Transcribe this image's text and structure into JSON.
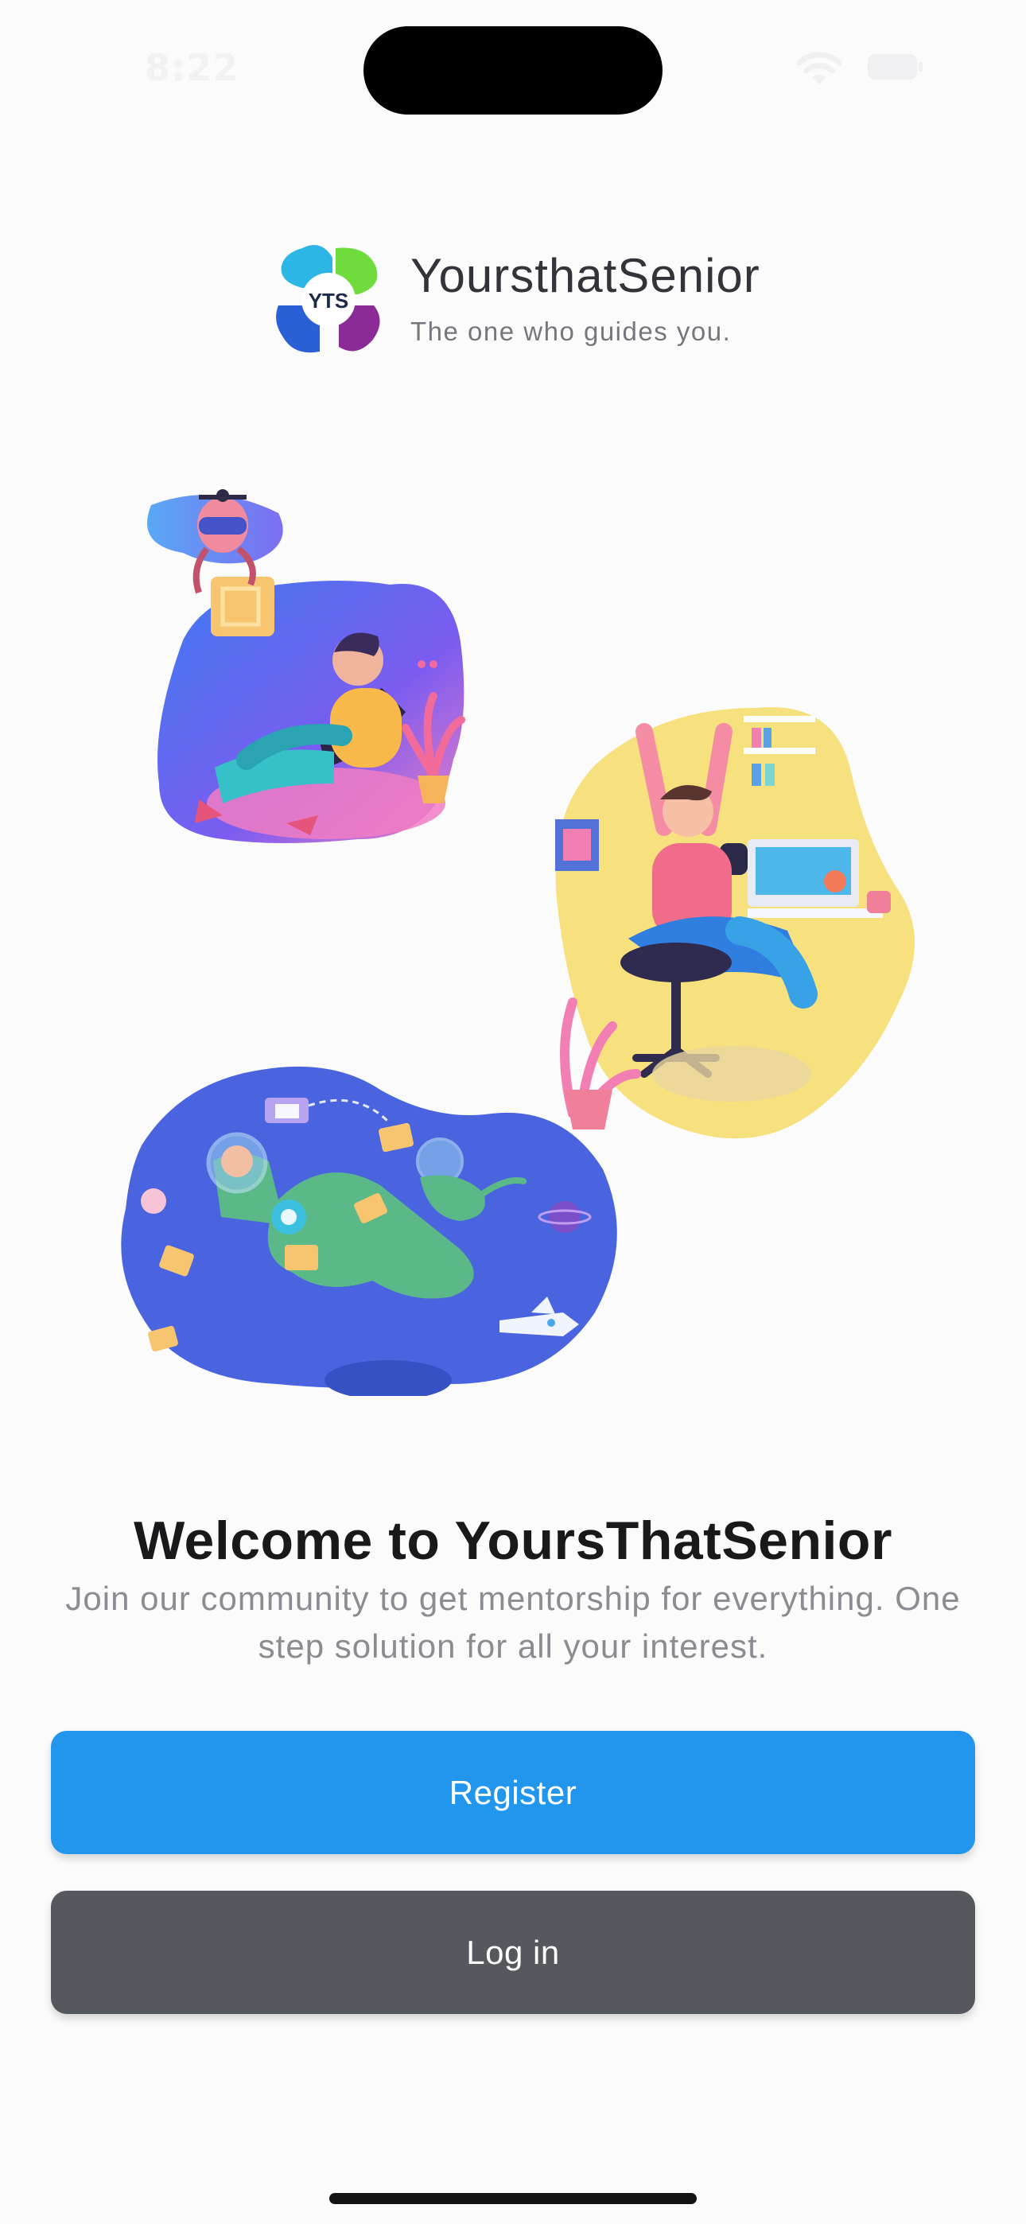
{
  "status_bar": {
    "time": "8:22",
    "icons": [
      "wifi-icon",
      "battery-icon"
    ]
  },
  "brand": {
    "logo_icon": "yts-logo-icon",
    "logo_text": "YTS",
    "name": "YoursthatSenior",
    "tagline": "The one who guides you."
  },
  "illustrations": [
    "relaxing-person-with-drone-illustration",
    "celebrating-person-at-desk-illustration",
    "astronaut-floating-illustration"
  ],
  "welcome": {
    "title": "Welcome to YoursThatSenior",
    "subtitle_line1": "Join our community to get mentorship for everything. One",
    "subtitle_line2": "step solution for all your interest."
  },
  "actions": {
    "register_label": "Register",
    "login_label": "Log in"
  },
  "colors": {
    "primary": "#2196ec",
    "secondary": "#55585d",
    "background": "#fbfbfc"
  }
}
